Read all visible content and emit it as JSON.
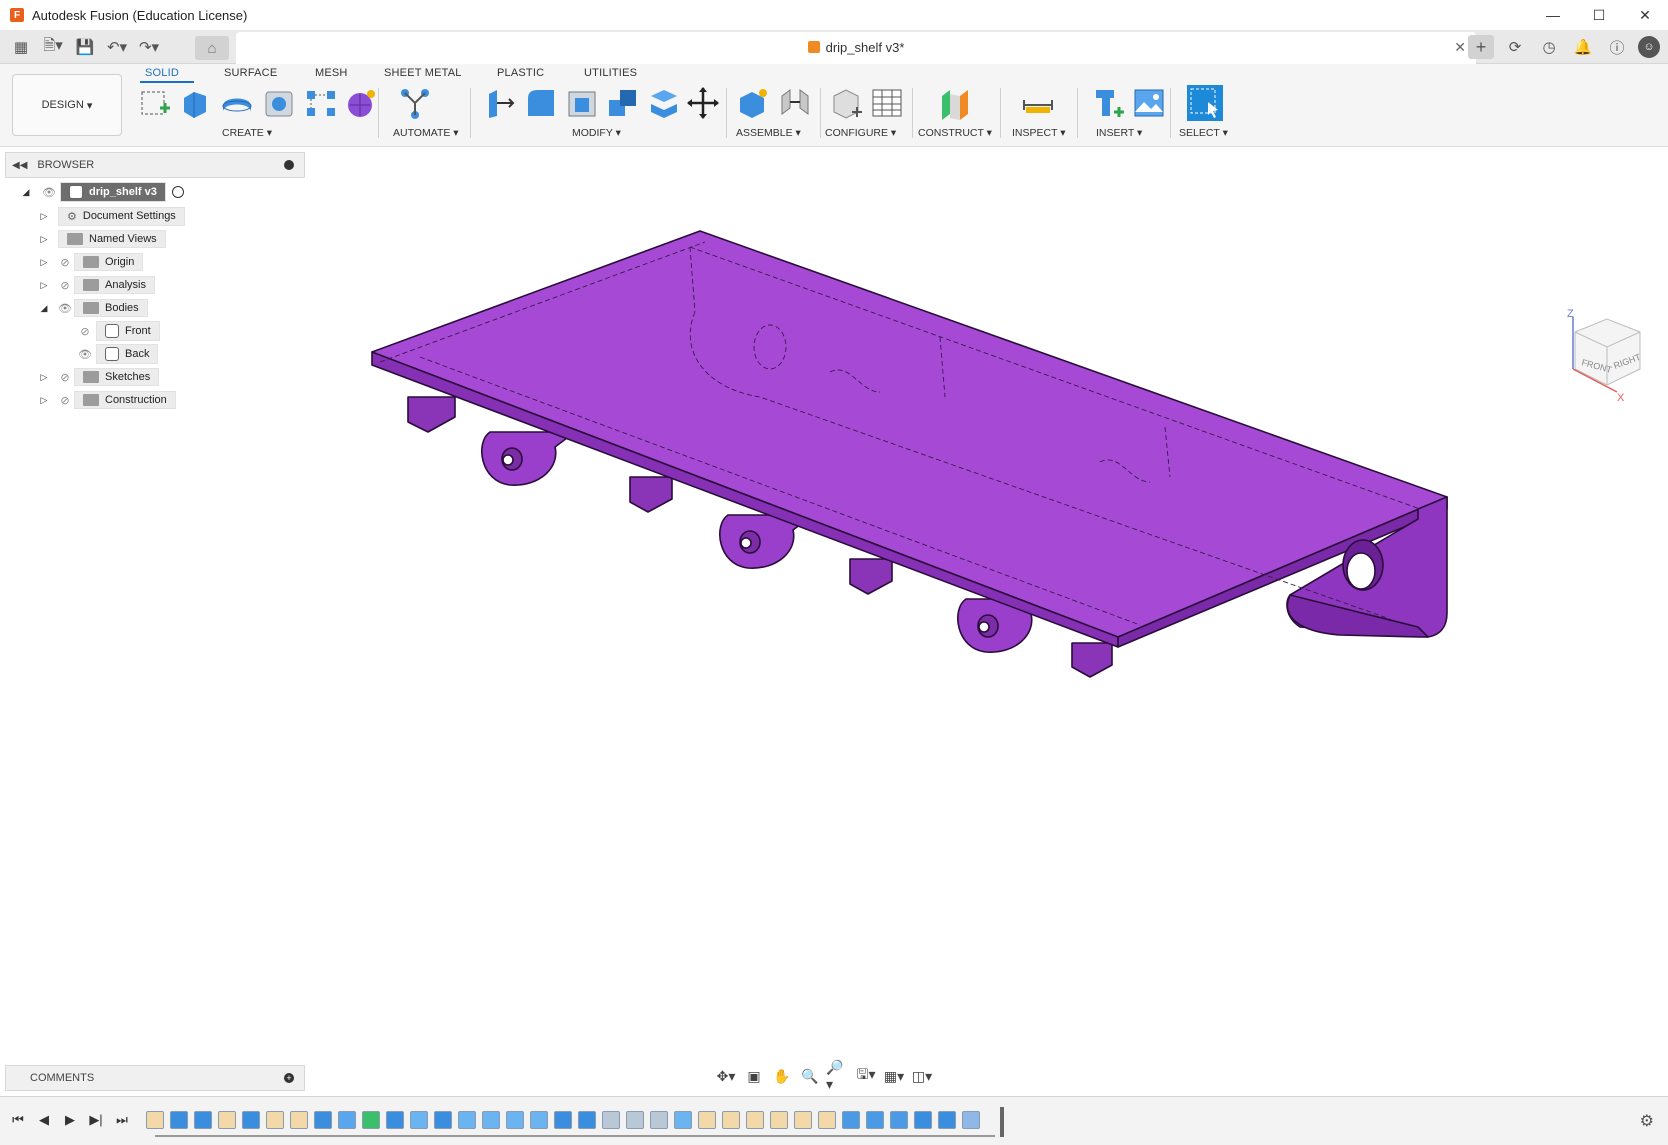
{
  "window": {
    "title": "Autodesk Fusion (Education License)",
    "app_icon": "F"
  },
  "document": {
    "tab_name": "drip_shelf v3*"
  },
  "ribbon": {
    "workspace": "DESIGN",
    "tabs": [
      "SOLID",
      "SURFACE",
      "MESH",
      "SHEET METAL",
      "PLASTIC",
      "UTILITIES"
    ],
    "groups": [
      "CREATE",
      "AUTOMATE",
      "MODIFY",
      "ASSEMBLE",
      "CONFIGURE",
      "CONSTRUCT",
      "INSPECT",
      "INSERT",
      "SELECT"
    ]
  },
  "browser": {
    "title": "BROWSER",
    "root": "drip_shelf v3",
    "items": [
      "Document Settings",
      "Named Views",
      "Origin",
      "Analysis",
      "Bodies",
      "Front",
      "Back",
      "Sketches",
      "Construction"
    ]
  },
  "viewcube": {
    "z": "Z",
    "x": "X",
    "front": "FRONT",
    "right": "RIGHT"
  },
  "comments": {
    "title": "COMMENTS"
  },
  "colors": {
    "accent": "#1c6fc4",
    "model": "#a64ad6",
    "model_edge": "#2a0d3a"
  }
}
